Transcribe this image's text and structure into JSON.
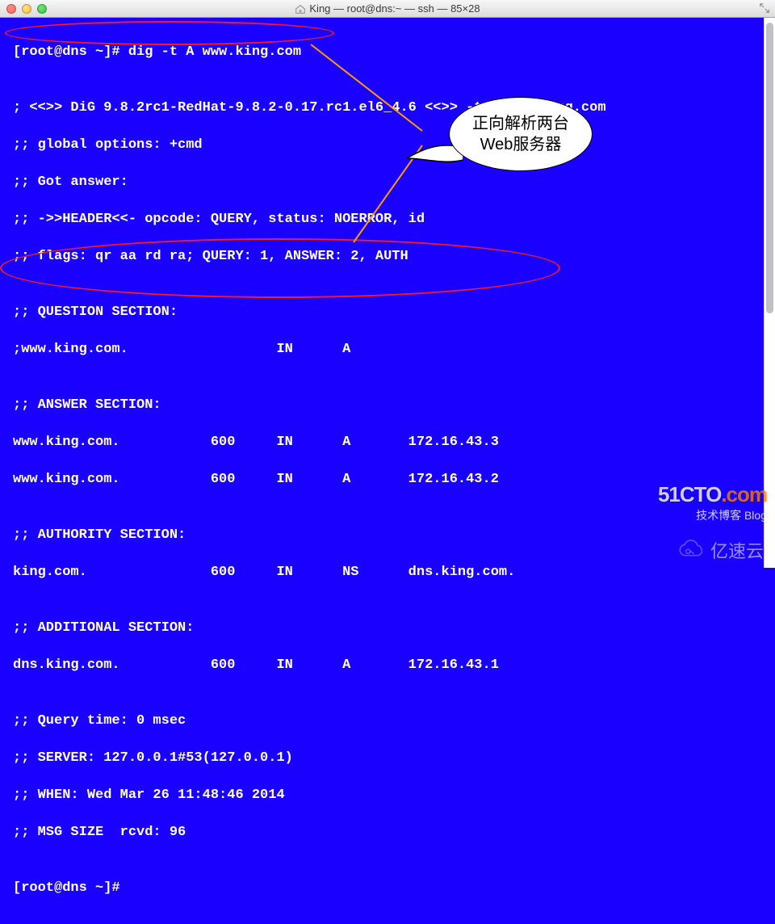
{
  "window": {
    "title": "King — root@dns:~ — ssh — 85×28"
  },
  "terminal": {
    "prompt1": "[root@dns ~]# ",
    "cmd": "dig -t A www.king.com",
    "l_blank": "",
    "l_version": "; <<>> DiG 9.8.2rc1-RedHat-9.8.2-0.17.rc1.el6_4.6 <<>> -t A www.king.com",
    "l_global": ";; global options: +cmd",
    "l_gotans": ";; Got answer:",
    "l_header": ";; ->>HEADER<<- opcode: QUERY, status: NOERROR, id",
    "l_flags": ";; flags: qr aa rd ra; QUERY: 1, ANSWER: 2, AUTH",
    "l_qsec": ";; QUESTION SECTION:",
    "l_q1": ";www.king.com.                  IN      A",
    "l_asec": ";; ANSWER SECTION:",
    "l_a1": "www.king.com.           600     IN      A       172.16.43.3",
    "l_a2": "www.king.com.           600     IN      A       172.16.43.2",
    "l_authsec": ";; AUTHORITY SECTION:",
    "l_auth1": "king.com.               600     IN      NS      dns.king.com.",
    "l_addsec": ";; ADDITIONAL SECTION:",
    "l_add1": "dns.king.com.           600     IN      A       172.16.43.1",
    "l_qtime": ";; Query time: 0 msec",
    "l_server": ";; SERVER: 127.0.0.1#53(127.0.0.1)",
    "l_when": ";; WHEN: Wed Mar 26 11:48:46 2014",
    "l_msg": ";; MSG SIZE  rcvd: 96",
    "prompt2": "[root@dns ~]#"
  },
  "annotation": {
    "line1": "正向解析两台",
    "line2": "Web服务器"
  },
  "watermarks": {
    "site_prefix": "51CTO",
    "site_suffix": ".com",
    "site_sub": "技术博客  Blog",
    "yisu_text": "亿速云"
  }
}
